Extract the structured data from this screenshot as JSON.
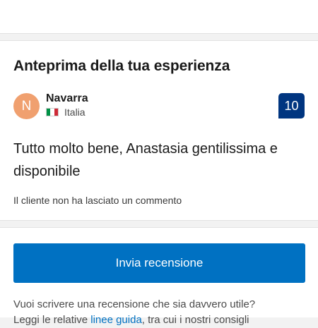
{
  "review_card": {
    "title": "Anteprima della tua esperienza",
    "reviewer": {
      "initial": "N",
      "name": "Navarra",
      "country": "Italia",
      "flag_colors": [
        "#009246",
        "#ffffff",
        "#ce2b37"
      ],
      "avatar_color": "#f0a06f"
    },
    "score": "10",
    "score_color": "#003580",
    "review_text": "Tutto molto bene, Anastasia gentilissima e disponibile",
    "no_comment_text": "Il cliente non ha lasciato un commento"
  },
  "actions": {
    "submit_label": "Invia recensione",
    "submit_color": "#0071c2"
  },
  "help": {
    "line1": "Vuoi scrivere una recensione che sia davvero utile?",
    "line2_prefix": "Leggi le relative ",
    "line2_link": "linee guida",
    "line2_suffix": ", tra cui i nostri consigli"
  }
}
